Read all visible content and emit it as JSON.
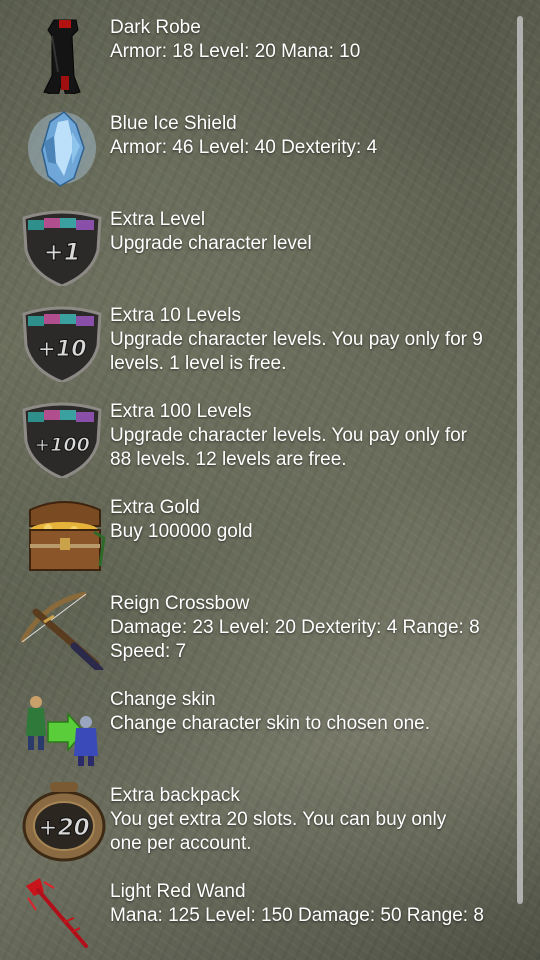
{
  "items": [
    {
      "title": "Dark Robe",
      "desc": "Armor: 18 Level: 20 Mana: 10",
      "icon": "dark-robe-icon"
    },
    {
      "title": "Blue Ice Shield",
      "desc": "Armor: 46 Level: 40 Dexterity: 4",
      "icon": "ice-shield-icon"
    },
    {
      "title": "Extra Level",
      "desc": "Upgrade character level",
      "icon": "level-badge-icon",
      "badge": "+1"
    },
    {
      "title": "Extra 10 Levels",
      "desc_line1": "Upgrade character levels. You pay only for 9",
      "desc_line2": "levels. 1 level is free.",
      "icon": "level-badge-icon",
      "badge": "+10"
    },
    {
      "title": "Extra 100 Levels",
      "desc_line1": "Upgrade character levels. You pay only for",
      "desc_line2": "88 levels. 12 levels are free.",
      "icon": "level-badge-icon",
      "badge": "+100"
    },
    {
      "title": "Extra Gold",
      "desc": "Buy 100000 gold",
      "icon": "treasure-chest-icon"
    },
    {
      "title": "Reign Crossbow",
      "desc_line1": "Damage: 23 Level: 20 Dexterity: 4 Range: 8",
      "desc_line2": "Speed: 7",
      "icon": "crossbow-icon"
    },
    {
      "title": "Change skin",
      "desc": "Change character skin to chosen one.",
      "icon": "change-skin-icon"
    },
    {
      "title": "Extra backpack",
      "desc_line1": "You get extra 20 slots. You can buy only",
      "desc_line2": "one per account.",
      "icon": "backpack-icon",
      "badge": "+20"
    },
    {
      "title": "Light Red Wand",
      "desc": "Mana: 125 Level: 150 Damage: 50 Range: 8",
      "icon": "red-wand-icon"
    }
  ]
}
